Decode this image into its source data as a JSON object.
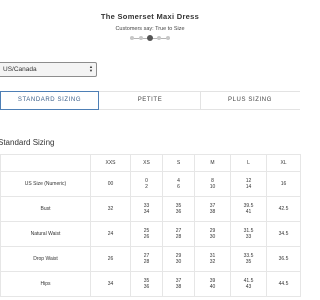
{
  "product": {
    "title": "The Somerset Maxi Dress",
    "fit_caption": "Customers say: True to Size"
  },
  "region_select": {
    "value": "US/Canada"
  },
  "tabs": [
    {
      "label": "STANDARD SIZING",
      "active": true
    },
    {
      "label": "PETITE",
      "active": false
    },
    {
      "label": "PLUS SIZING",
      "active": false
    }
  ],
  "section_title": "Standard Sizing",
  "table": {
    "headers": [
      "",
      "XXS",
      "XS",
      "S",
      "M",
      "L",
      "XL"
    ],
    "rows": [
      {
        "label": "US Size (Numeric)",
        "cells": [
          [
            "00"
          ],
          [
            "0",
            "2"
          ],
          [
            "4",
            "6"
          ],
          [
            "8",
            "10"
          ],
          [
            "12",
            "14"
          ],
          [
            "16"
          ]
        ]
      },
      {
        "label": "Bust",
        "cells": [
          [
            "32"
          ],
          [
            "33",
            "34"
          ],
          [
            "35",
            "36"
          ],
          [
            "37",
            "38"
          ],
          [
            "39.5",
            "41"
          ],
          [
            "42.5"
          ]
        ]
      },
      {
        "label": "Natural Waist",
        "cells": [
          [
            "24"
          ],
          [
            "25",
            "26"
          ],
          [
            "27",
            "28"
          ],
          [
            "29",
            "30"
          ],
          [
            "31.5",
            "33"
          ],
          [
            "34.5"
          ]
        ]
      },
      {
        "label": "Drop Waist",
        "cells": [
          [
            "26"
          ],
          [
            "27",
            "28"
          ],
          [
            "29",
            "30"
          ],
          [
            "31",
            "32"
          ],
          [
            "33.5",
            "35"
          ],
          [
            "36.5"
          ]
        ]
      },
      {
        "label": "Hips",
        "cells": [
          [
            "34"
          ],
          [
            "35",
            "36"
          ],
          [
            "37",
            "38"
          ],
          [
            "39",
            "40"
          ],
          [
            "41.5",
            "43"
          ],
          [
            "44.5"
          ]
        ]
      }
    ]
  },
  "colors": {
    "accent": "#4e7fb5",
    "border": "#e6e6e6"
  },
  "icons": {
    "select": "up-down-arrows-icon",
    "fit_marker": "fit-indicator-icon"
  }
}
